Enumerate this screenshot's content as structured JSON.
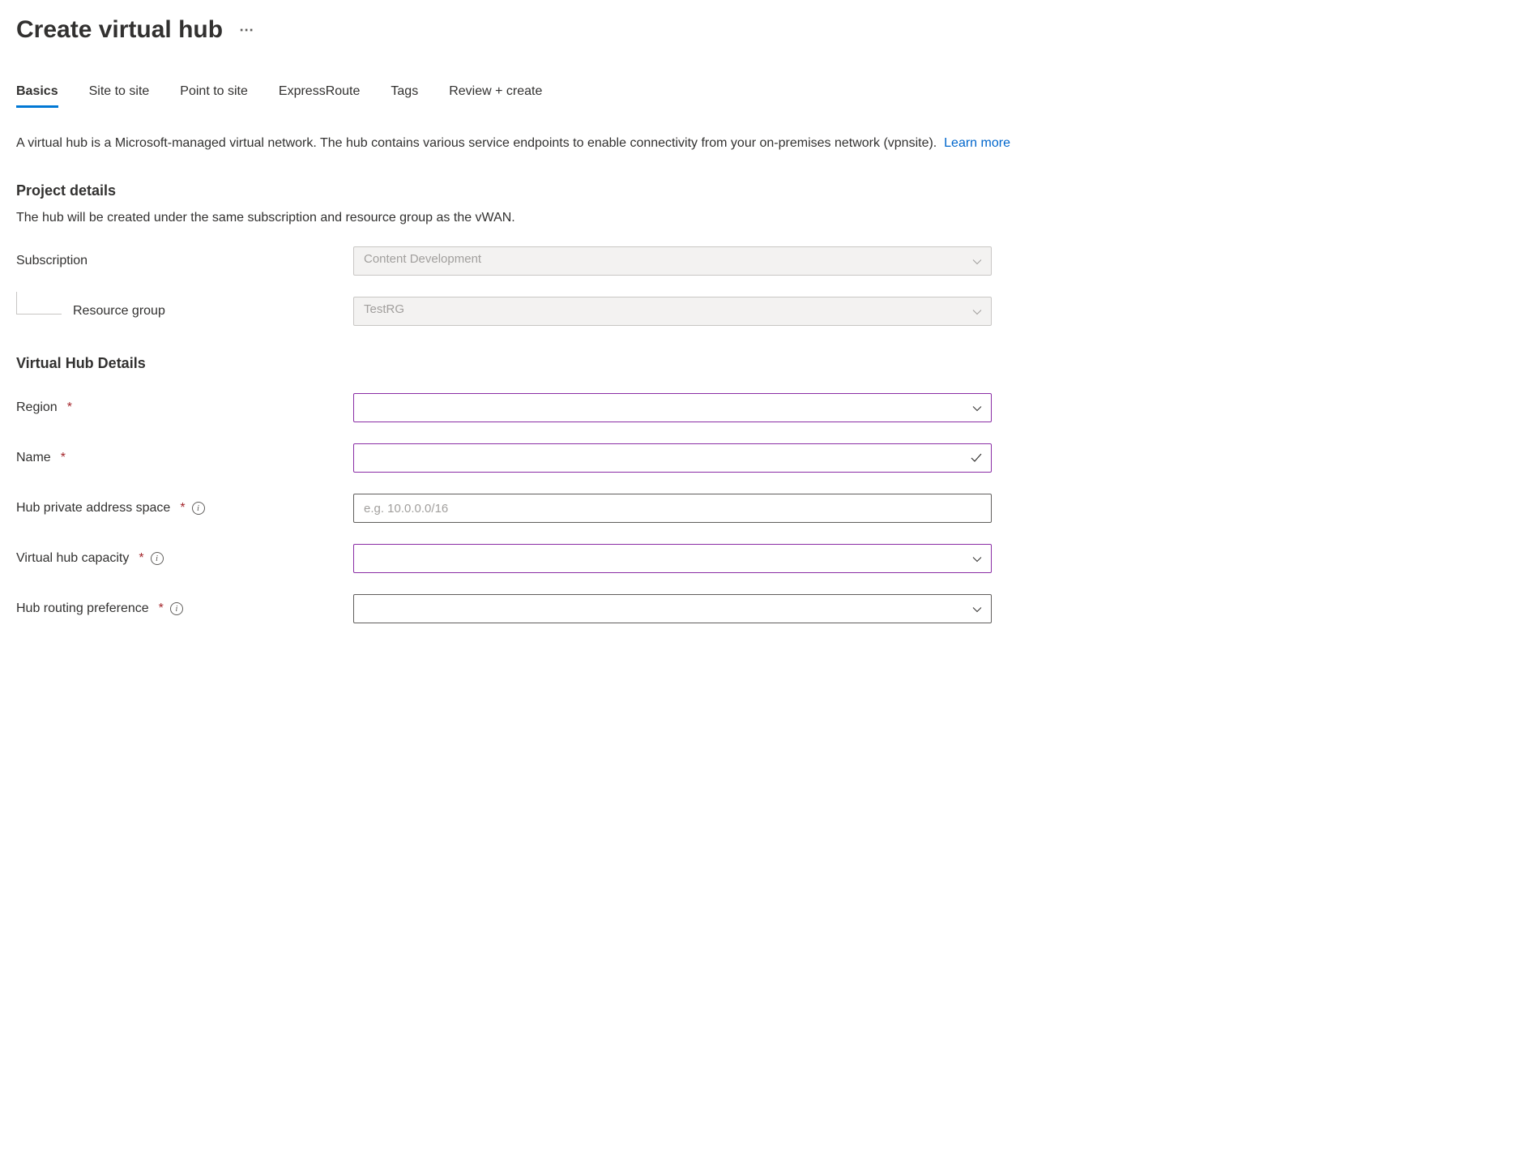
{
  "page": {
    "title": "Create virtual hub"
  },
  "tabs": {
    "basics": "Basics",
    "siteToSite": "Site to site",
    "pointToSite": "Point to site",
    "expressRoute": "ExpressRoute",
    "tags": "Tags",
    "reviewCreate": "Review + create"
  },
  "description": {
    "text": "A virtual hub is a Microsoft-managed virtual network. The hub contains various service endpoints to enable connectivity from your on-premises network (vpnsite).",
    "learnMore": "Learn more"
  },
  "projectDetails": {
    "heading": "Project details",
    "note": "The hub will be created under the same subscription and resource group as the vWAN.",
    "subscription": {
      "label": "Subscription",
      "value": "Content Development"
    },
    "resourceGroup": {
      "label": "Resource group",
      "value": "TestRG"
    }
  },
  "virtualHubDetails": {
    "heading": "Virtual Hub Details",
    "region": {
      "label": "Region",
      "value": ""
    },
    "name": {
      "label": "Name",
      "value": ""
    },
    "addressSpace": {
      "label": "Hub private address space",
      "placeholder": "e.g. 10.0.0.0/16",
      "value": ""
    },
    "capacity": {
      "label": "Virtual hub capacity",
      "value": ""
    },
    "routingPreference": {
      "label": "Hub routing preference",
      "value": ""
    }
  }
}
